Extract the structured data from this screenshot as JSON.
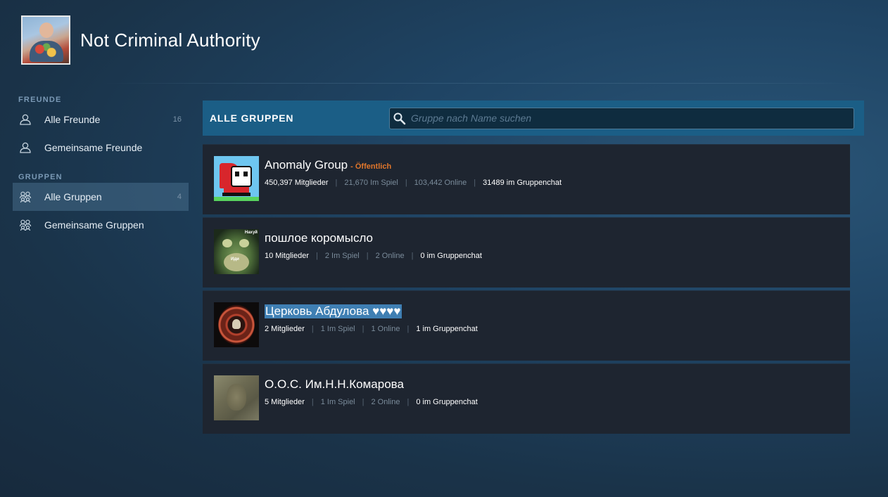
{
  "profile": {
    "name": "Not Criminal Authority"
  },
  "sidebar": {
    "friends_section": "FREUNDE",
    "groups_section": "GRUPPEN",
    "items": [
      {
        "label": "Alle Freunde",
        "count": "16",
        "icon": "person-icon"
      },
      {
        "label": "Gemeinsame Freunde",
        "count": "",
        "icon": "person-icon"
      },
      {
        "label": "Alle Gruppen",
        "count": "4",
        "icon": "group-icon",
        "active": true
      },
      {
        "label": "Gemeinsame Gruppen",
        "count": "",
        "icon": "group-icon"
      }
    ]
  },
  "main": {
    "title": "ALLE GRUPPEN",
    "search": {
      "placeholder": "Gruppe nach Name suchen",
      "value": ""
    },
    "groups": [
      {
        "name": "Anomaly Group",
        "visibility": "- Öffentlich",
        "members": "450,397 Mitglieder",
        "in_game": "21,670 Im Spiel",
        "online": "103,442 Online",
        "chat": "31489 im Gruppenchat"
      },
      {
        "name": "пошлое коромысло",
        "visibility": "",
        "members": "10 Mitglieder",
        "in_game": "2 Im Spiel",
        "online": "2 Online",
        "chat": "0 im Gruppenchat",
        "avatar_caption_top": "Нахуй",
        "avatar_caption_mid": "Иди"
      },
      {
        "name": "Церковь Абдулова ♥♥♥♥",
        "visibility": "",
        "members": "2 Mitglieder",
        "in_game": "1 Im Spiel",
        "online": "1 Online",
        "chat": "1 im Gruppenchat",
        "selected": true
      },
      {
        "name": "О.О.С. Им.Н.Н.Комарова",
        "visibility": "",
        "members": "5 Mitglieder",
        "in_game": "1 Im Spiel",
        "online": "2 Online",
        "chat": "0 im Gruppenchat"
      }
    ]
  },
  "colors": {
    "header_bar": "#1b5e86",
    "row_bg": "#1e2530",
    "visibility_public": "#e0762b",
    "selection": "#3f7fb3"
  }
}
